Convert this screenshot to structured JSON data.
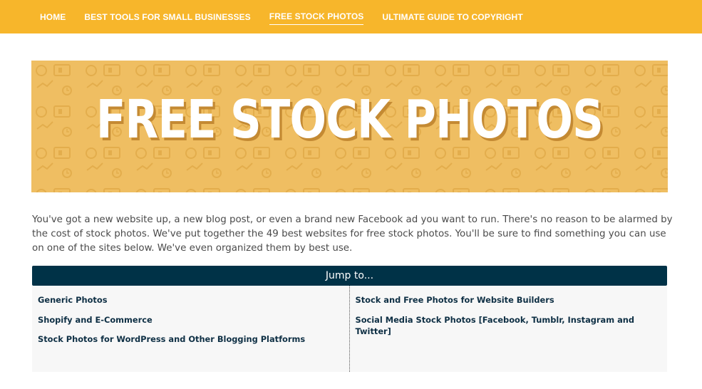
{
  "nav": {
    "items": [
      {
        "label": "HOME"
      },
      {
        "label": "BEST TOOLS FOR SMALL BUSINESSES"
      },
      {
        "label": "FREE STOCK PHOTOS"
      },
      {
        "label": "ULTIMATE GUIDE TO COPYRIGHT"
      }
    ],
    "active_index": 2
  },
  "hero": {
    "title": "FREE STOCK PHOTOS",
    "background_color": "#efbe62",
    "pattern_icons": [
      "dollar-icon",
      "wallet-icon",
      "clock-icon",
      "chart-icon"
    ]
  },
  "intro": {
    "text": "You've got a new website up, a new blog post, or even a brand new Facebook ad you want to run. There's no reason to be alarmed by the cost of stock photos. We've put together the 49 best websites for free stock photos. You'll be sure to find something you can use on one of the sites below. We've even organized them by best use."
  },
  "jump": {
    "header": "Jump to...",
    "left_links": [
      {
        "label": "Generic Photos"
      },
      {
        "label": "Shopify and E-Commerce"
      },
      {
        "label": "Stock Photos for WordPress and Other Blogging Platforms"
      }
    ],
    "right_links": [
      {
        "label": "Stock and Free Photos for Website Builders"
      },
      {
        "label": "Social Media Stock Photos [Facebook, Tumblr, Instagram and Twitter]"
      }
    ]
  },
  "colors": {
    "nav_bg": "#f7b62b",
    "jump_header_bg": "#003247",
    "link_color": "#0e2f44"
  }
}
